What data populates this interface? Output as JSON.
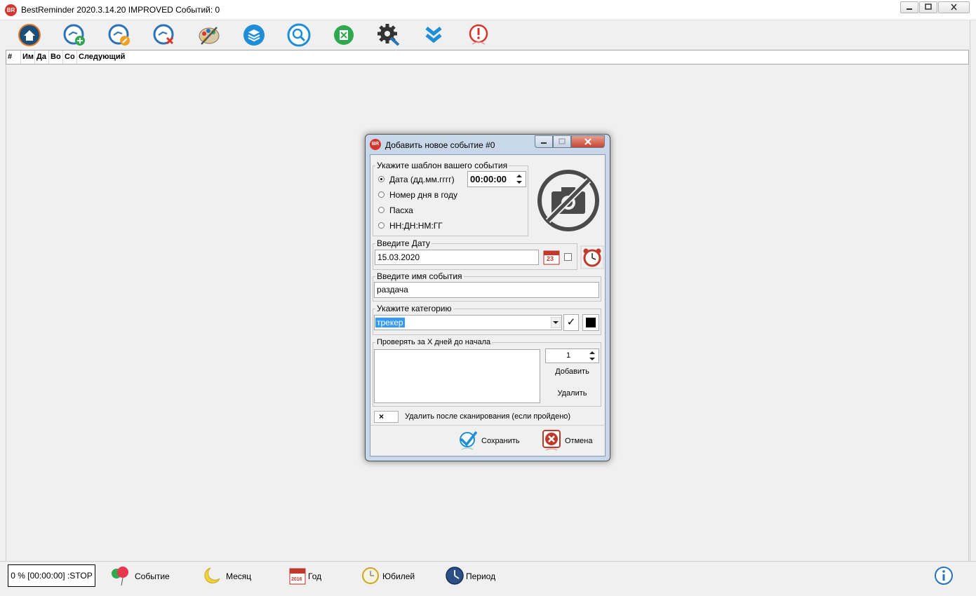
{
  "window": {
    "title": "BestReminder 2020.3.14.20 IMPROVED    Событий:  0",
    "logo_text": "BR"
  },
  "toolbar": {
    "icons": [
      "home-icon",
      "add-event-icon",
      "edit-event-icon",
      "delete-event-icon",
      "palette-icon",
      "layers-icon",
      "search-icon",
      "excel-icon",
      "settings-icon",
      "collapse-icon",
      "alert-icon"
    ]
  },
  "list": {
    "columns": [
      "#",
      "Им",
      "Да",
      "Во",
      "Со",
      "Следующий"
    ]
  },
  "status": {
    "progress_text": "0 % [00:00:00] :STOP",
    "items": [
      "Событие",
      "Месяц",
      "Год",
      "Юбилей",
      "Период"
    ],
    "year_badge": "2016"
  },
  "dialog": {
    "title": "Добавить новое событие #0",
    "template_group": "Укажите шаблон вашего события",
    "radio_date": "Дата (дд.мм.гггг)",
    "time_value": "00:00:00",
    "radio_day_number": "Номер дня в году",
    "radio_easter": "Пасха",
    "radio_custom": "НН:ДН:НМ:ГГ",
    "date_group": "Введите Дату",
    "date_value": "15.03.2020",
    "calendar_badge": "23",
    "name_group": "Введите  имя события",
    "name_value": "раздача",
    "category_group": "Укажите категорию",
    "category_value": "трекер",
    "check_symbol": "✓",
    "days_group": "Проверять за X дней до начала",
    "days_value": "1",
    "add_label": "Добавить",
    "remove_label": "Удалить",
    "delete_after_mark": "×",
    "delete_after_label": "Удалить после сканирования (если пройдено)",
    "save_label": "Сохранить",
    "cancel_label": "Отмена"
  },
  "colors": {
    "accent": "#1e73be",
    "danger": "#d9342b",
    "dialog_frame": "#c8d8ea",
    "selection": "#3399ff"
  }
}
